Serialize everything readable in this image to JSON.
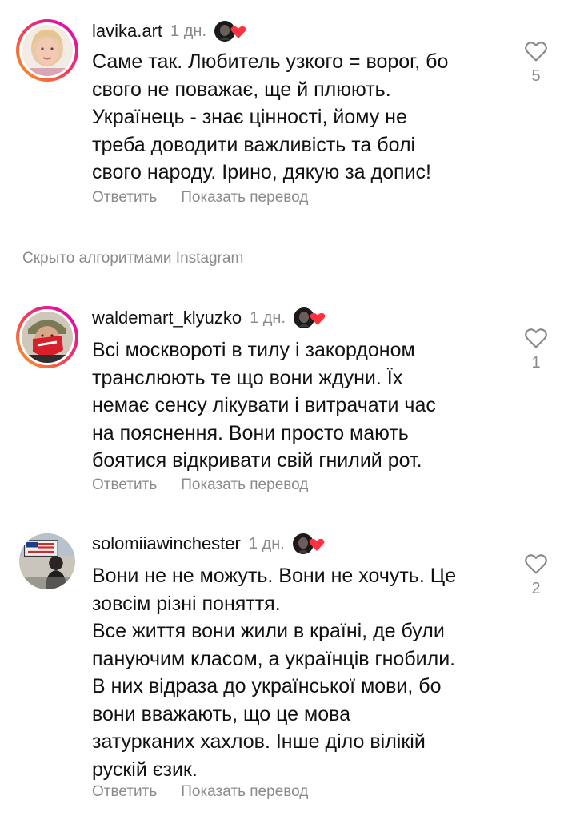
{
  "colors": {
    "text": "#111111",
    "secondary": "#8a8a8a",
    "story_ring_start": "#f9a11b",
    "story_ring_end": "#d300c5",
    "heart_red": "#ff3040"
  },
  "actions": {
    "reply_label": "Ответить",
    "translate_label": "Показать перевод"
  },
  "hidden_separator": {
    "label": "Скрыто алгоритмами Instagram"
  },
  "comments": [
    {
      "username": "lavika.art",
      "time": "1 дн.",
      "text": "Саме так. Любитель узкого = ворог, бо\nсвого не поважає, ще й плюють.\nУкраїнець - знає цінності, йому не\nтреба доводити важливість та болі\nсвого народу. Ірино, дякую за допис!",
      "likes": "5",
      "liked_by_author": true,
      "avatar_icon": "woman-avatar-icon"
    },
    {
      "username": "waldemart_klyuzko",
      "time": "1 дн.",
      "text": "Всі москвороті в тилу і закордоном\nтранслюють те що вони ждуни. Їх\nнемає сенсу лікувати і витрачати час\nна пояснення. Вони просто мають\nбоятися відкривати свій гнилий рот.",
      "likes": "1",
      "liked_by_author": true,
      "avatar_icon": "masked-man-avatar-icon"
    },
    {
      "username": "solomiiawinchester",
      "time": "1 дн.",
      "text": "Вони не не можуть. Вони не хочуть. Це\nзовсім різні поняття.\nВсе життя вони жили в країні, де були\nпануючим класом, а українців гнобили.\nВ них відраза до української мови, бо\nвони вважають, що це мова\nзатурканих хахлов. Інше діло вілікій\nрускій єзик.",
      "likes": "2",
      "liked_by_author": true,
      "avatar_icon": "protest-sign-avatar-icon"
    }
  ]
}
